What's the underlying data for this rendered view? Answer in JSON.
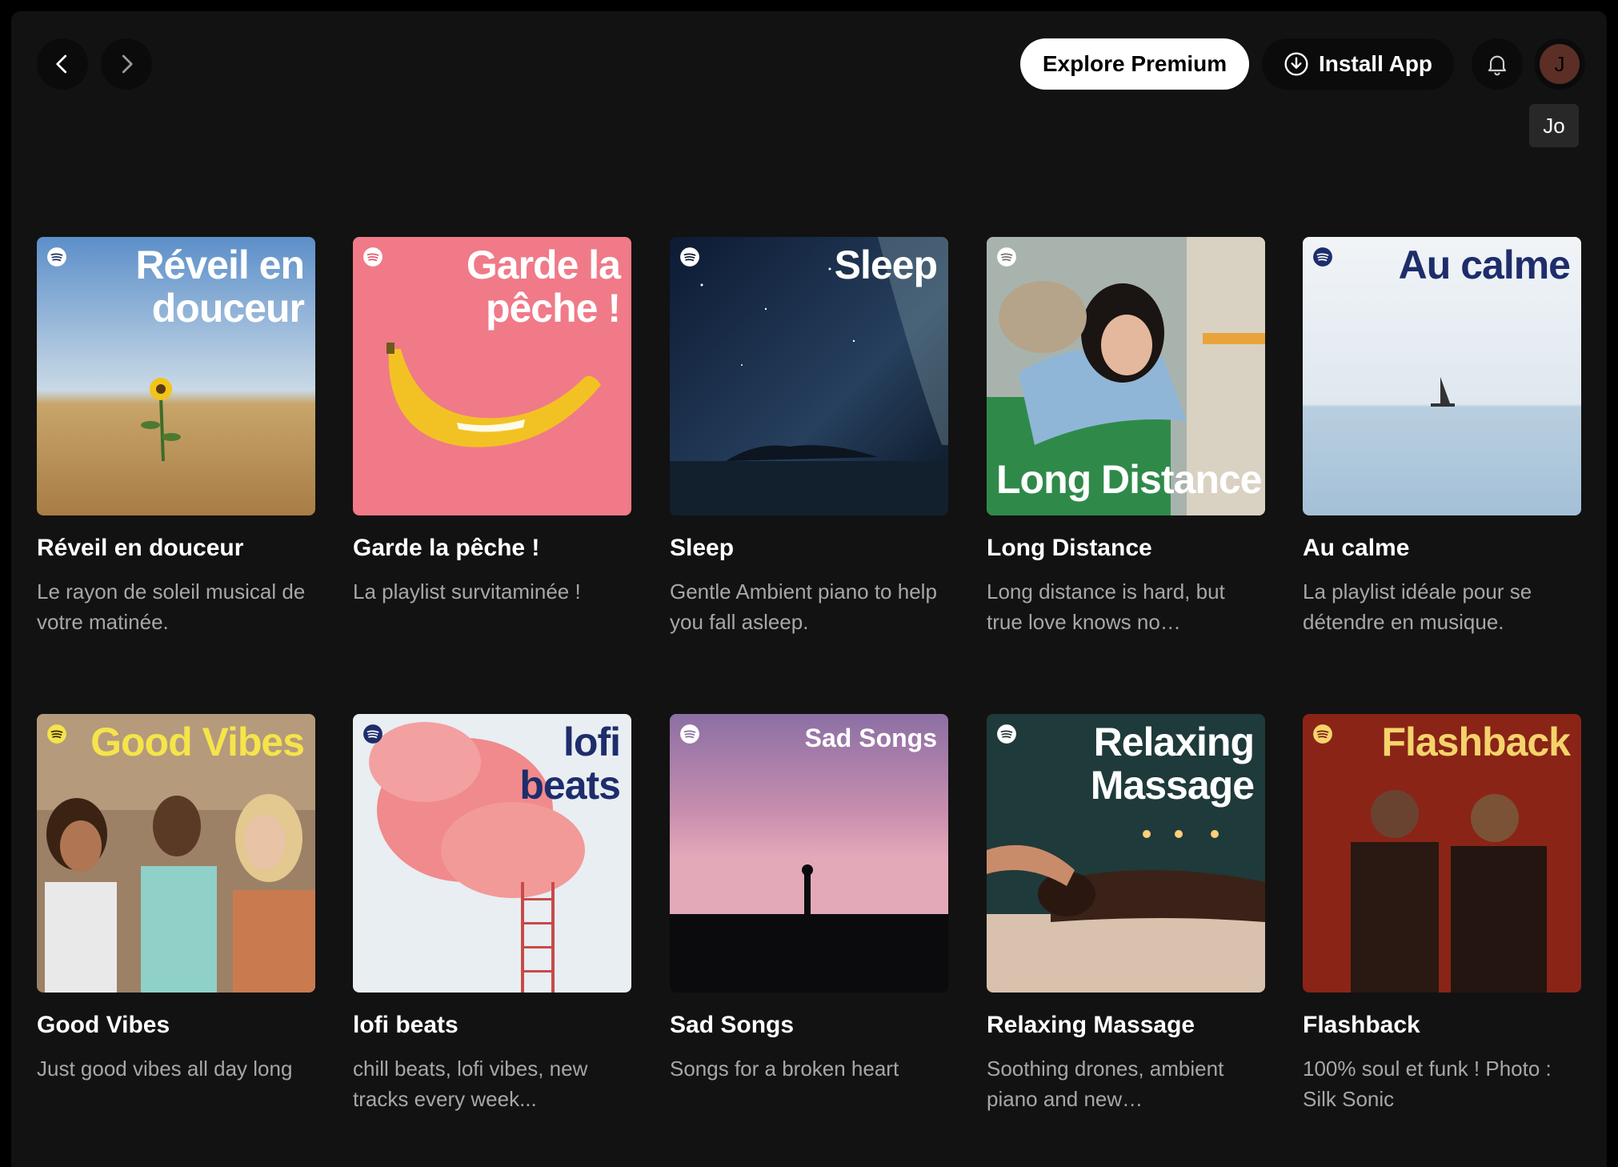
{
  "topbar": {
    "explore_premium": "Explore Premium",
    "install_app": "Install App",
    "avatar_initial": "J",
    "tooltip": "Jo"
  },
  "playlists": [
    {
      "cover_text": "Réveil en douceur",
      "title": "Réveil en douceur",
      "description": "Le rayon de soleil musical de votre matinée."
    },
    {
      "cover_text": "Garde la pêche !",
      "title": "Garde la pêche !",
      "description": "La playlist survitaminée !"
    },
    {
      "cover_text": "Sleep",
      "title": "Sleep",
      "description": "Gentle Ambient piano to help you fall asleep."
    },
    {
      "cover_text": "Long Distance",
      "title": "Long Distance",
      "description": "Long distance is hard, but true love knows no…"
    },
    {
      "cover_text": "Au calme",
      "title": "Au calme",
      "description": "La playlist idéale pour se détendre en musique."
    },
    {
      "cover_text": "Good Vibes",
      "title": "Good Vibes",
      "description": "Just good vibes all day long"
    },
    {
      "cover_text": "lofi beats",
      "title": "lofi beats",
      "description": "chill beats, lofi vibes, new tracks every week..."
    },
    {
      "cover_text": "Sad Songs",
      "title": "Sad Songs",
      "description": "Songs for a broken heart"
    },
    {
      "cover_text": "Relaxing Massage",
      "title": "Relaxing Massage",
      "description": "Soothing drones, ambient piano and new…"
    },
    {
      "cover_text": "Flashback",
      "title": "Flashback",
      "description": "100% soul et funk ! Photo : Silk Sonic"
    }
  ],
  "colors": {
    "background": "#121212",
    "text_secondary": "#a7a7a7",
    "brand_accent": "#1ed760"
  }
}
